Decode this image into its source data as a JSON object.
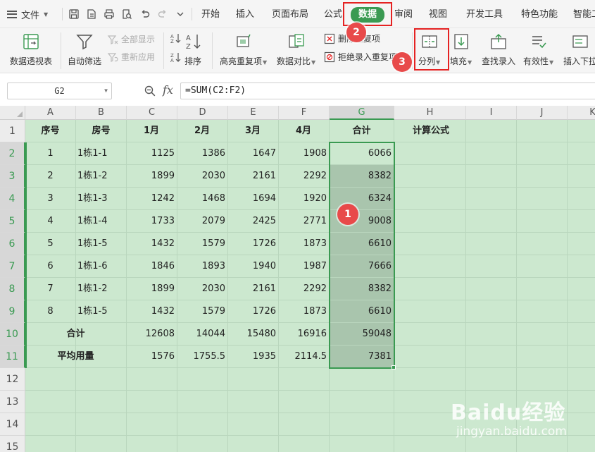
{
  "menubar": {
    "file_label": "文件",
    "tabs": [
      "开始",
      "插入",
      "页面布局",
      "公式",
      "数据",
      "审阅",
      "视图",
      "开发工具",
      "特色功能",
      "智能工"
    ],
    "active_tab": "数据"
  },
  "ribbon": {
    "pivot": "数据透视表",
    "autofilter": "自动筛选",
    "show_all": "全部显示",
    "reapply": "重新应用",
    "sort": "排序",
    "highlight_dup": "高亮重复项",
    "compare": "数据对比",
    "remove_dup": "删除重复项",
    "reject_dup": "拒绝录入重复项",
    "split": "分列",
    "fill": "填充",
    "lookup_entry": "查找录入",
    "validity": "有效性",
    "insert_dropdown": "插入下拉"
  },
  "formula_bar": {
    "name_box": "G2",
    "fx_symbol": "fx",
    "formula": "=SUM(C2:F2)"
  },
  "sheet": {
    "col_headers": [
      "A",
      "B",
      "C",
      "D",
      "E",
      "F",
      "G",
      "H",
      "I",
      "J",
      "K"
    ],
    "row_headers": [
      "1",
      "2",
      "3",
      "4",
      "5",
      "6",
      "7",
      "8",
      "9",
      "10",
      "11",
      "12",
      "13",
      "14",
      "15"
    ],
    "header_row": [
      "序号",
      "房号",
      "1月",
      "2月",
      "3月",
      "4月",
      "合计",
      "计算公式"
    ],
    "rows": [
      [
        "1",
        "1栋1-1",
        "1125",
        "1386",
        "1647",
        "1908",
        "6066"
      ],
      [
        "2",
        "1栋1-2",
        "1899",
        "2030",
        "2161",
        "2292",
        "8382"
      ],
      [
        "3",
        "1栋1-3",
        "1242",
        "1468",
        "1694",
        "1920",
        "6324"
      ],
      [
        "4",
        "1栋1-4",
        "1733",
        "2079",
        "2425",
        "2771",
        "9008"
      ],
      [
        "5",
        "1栋1-5",
        "1432",
        "1579",
        "1726",
        "1873",
        "6610"
      ],
      [
        "6",
        "1栋1-6",
        "1846",
        "1893",
        "1940",
        "1987",
        "7666"
      ],
      [
        "7",
        "1栋1-2",
        "1899",
        "2030",
        "2161",
        "2292",
        "8382"
      ],
      [
        "8",
        "1栋1-5",
        "1432",
        "1579",
        "1726",
        "1873",
        "6610"
      ]
    ],
    "total_row": [
      "合计",
      "12608",
      "14044",
      "15480",
      "16916",
      "59048"
    ],
    "avg_row": [
      "平均用量",
      "1576",
      "1755.5",
      "1935",
      "2114.5",
      "7381"
    ],
    "selected_cell": "G2"
  },
  "annotations": {
    "badge_1": "1",
    "badge_2": "2",
    "badge_3": "3"
  },
  "watermark": {
    "brand": "Baidu经验",
    "site": "jingyan.baidu.com"
  },
  "colors": {
    "accent": "#3a9a52",
    "sheet_bg": "#cce8cf",
    "selection_bg": "#a9c5ad",
    "highlight_red": "#e52222"
  }
}
